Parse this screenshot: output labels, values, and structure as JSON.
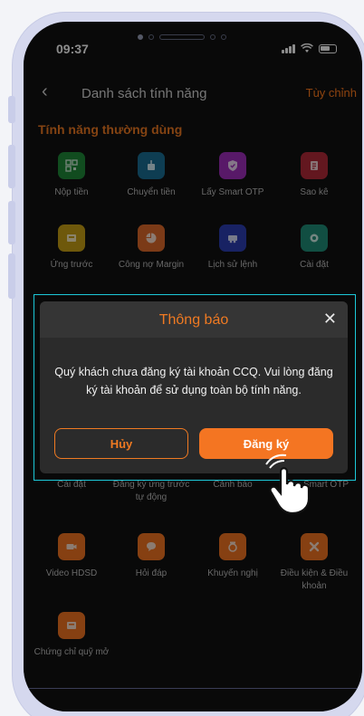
{
  "status": {
    "time": "09:37"
  },
  "header": {
    "back_icon": "chevron-left-icon",
    "title": "Danh sách tính năng",
    "customize": "Tùy chỉnh"
  },
  "section": {
    "title": "Tính năng thường dùng"
  },
  "features_top": [
    {
      "label": "Nộp tiền",
      "icon": "qr-icon",
      "color": "#1f8a3a"
    },
    {
      "label": "Chuyển tiền",
      "icon": "transfer-icon",
      "color": "#1a6f96"
    },
    {
      "label": "Lấy Smart OTP",
      "icon": "shield-icon",
      "color": "#a12fbe"
    },
    {
      "label": "Sao kê",
      "icon": "statement-icon",
      "color": "#b42a3a"
    },
    {
      "label": "Ứng trước",
      "icon": "advance-icon",
      "color": "#c9a114"
    },
    {
      "label": "Công nợ Margin",
      "icon": "pie-chart-icon",
      "color": "#e06a2a"
    },
    {
      "label": "Lịch sử lệnh",
      "icon": "history-icon",
      "color": "#2d3fb5"
    },
    {
      "label": "Cài đặt",
      "icon": "settings-icon",
      "color": "#1f8f79"
    }
  ],
  "features_bottom": [
    {
      "label": "Cài đặt"
    },
    {
      "label": "Đăng ký ứng trước tự động"
    },
    {
      "label": "Cảnh báo"
    },
    {
      "label": "Smart OTP"
    },
    {
      "label": "Video HDSD",
      "icon": "video-icon"
    },
    {
      "label": "Hỏi đáp",
      "icon": "chat-icon"
    },
    {
      "label": "Khuyến nghị",
      "icon": "recommend-icon"
    },
    {
      "label": "Điều kiện & Điều khoản",
      "icon": "terms-icon"
    },
    {
      "label": "Chứng chỉ quỹ mở",
      "icon": "fund-icon"
    }
  ],
  "dialog": {
    "title": "Thông báo",
    "close_icon": "close-icon",
    "message": "Quý khách chưa đăng ký tài khoản CCQ. Vui lòng đăng ký tài khoản để sử dụng toàn bộ tính năng.",
    "cancel": "Hủy",
    "register": "Đăng ký"
  },
  "overlay": {
    "pointer_icon": "hand-pointer-icon"
  }
}
